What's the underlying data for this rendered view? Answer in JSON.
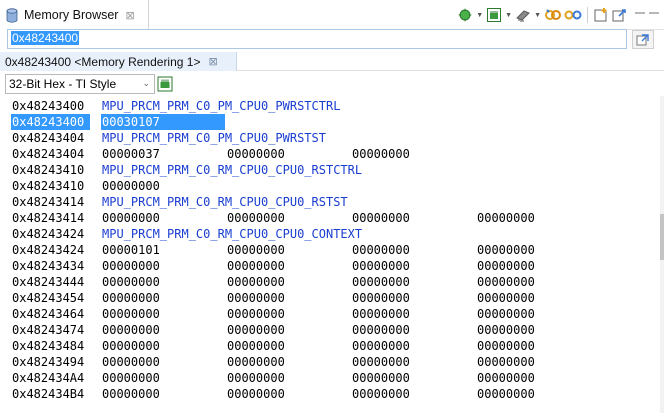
{
  "view_tab": {
    "label": "Memory Browser",
    "close_glyph": "⊠"
  },
  "toolbar": {
    "icons": [
      "refresh-icon",
      "memory-chip-icon",
      "memory-export-icon",
      "link-icon",
      "unlink-icon",
      "new-tab-icon",
      "pin-icon",
      "minimize-icon",
      "maximize-icon"
    ]
  },
  "address_bar": {
    "value": "0x48243400"
  },
  "rendering_tab": {
    "label": "0x48243400 <Memory Rendering 1>",
    "close_glyph": "⊠"
  },
  "format": {
    "selected": "32-Bit Hex - TI Style",
    "chevron": "⌄"
  },
  "memory_rows": [
    {
      "address": "0x48243400",
      "register": "MPU_PRCM_PRM_C0_PM_CPU0_PWRSTCTRL"
    },
    {
      "address": "0x48243400",
      "values": [
        "00030107"
      ],
      "highlighted": true
    },
    {
      "address": "0x48243404",
      "register": "MPU_PRCM_PRM_C0_PM_CPU0_PWRSTST"
    },
    {
      "address": "0x48243404",
      "values": [
        "00000037",
        "00000000",
        "00000000"
      ]
    },
    {
      "address": "0x48243410",
      "register": "MPU_PRCM_PRM_C0_RM_CPU0_CPU0_RSTCTRL"
    },
    {
      "address": "0x48243410",
      "values": [
        "00000000"
      ]
    },
    {
      "address": "0x48243414",
      "register": "MPU_PRCM_PRM_C0_RM_CPU0_CPU0_RSTST"
    },
    {
      "address": "0x48243414",
      "values": [
        "00000000",
        "00000000",
        "00000000",
        "00000000"
      ]
    },
    {
      "address": "0x48243424",
      "register": "MPU_PRCM_PRM_C0_RM_CPU0_CPU0_CONTEXT"
    },
    {
      "address": "0x48243424",
      "values": [
        "00000101",
        "00000000",
        "00000000",
        "00000000"
      ]
    },
    {
      "address": "0x48243434",
      "values": [
        "00000000",
        "00000000",
        "00000000",
        "00000000"
      ]
    },
    {
      "address": "0x48243444",
      "values": [
        "00000000",
        "00000000",
        "00000000",
        "00000000"
      ]
    },
    {
      "address": "0x48243454",
      "values": [
        "00000000",
        "00000000",
        "00000000",
        "00000000"
      ]
    },
    {
      "address": "0x48243464",
      "values": [
        "00000000",
        "00000000",
        "00000000",
        "00000000"
      ]
    },
    {
      "address": "0x48243474",
      "values": [
        "00000000",
        "00000000",
        "00000000",
        "00000000"
      ]
    },
    {
      "address": "0x48243484",
      "values": [
        "00000000",
        "00000000",
        "00000000",
        "00000000"
      ]
    },
    {
      "address": "0x48243494",
      "values": [
        "00000000",
        "00000000",
        "00000000",
        "00000000"
      ]
    },
    {
      "address": "0x482434A4",
      "values": [
        "00000000",
        "00000000",
        "00000000",
        "00000000"
      ]
    },
    {
      "address": "0x482434B4",
      "values": [
        "00000000",
        "00000000",
        "00000000",
        "00000000"
      ]
    }
  ],
  "colors": {
    "register_name": "#1a3ed1",
    "selection": "#3399ff",
    "tab_active": "#e8f1fb"
  }
}
